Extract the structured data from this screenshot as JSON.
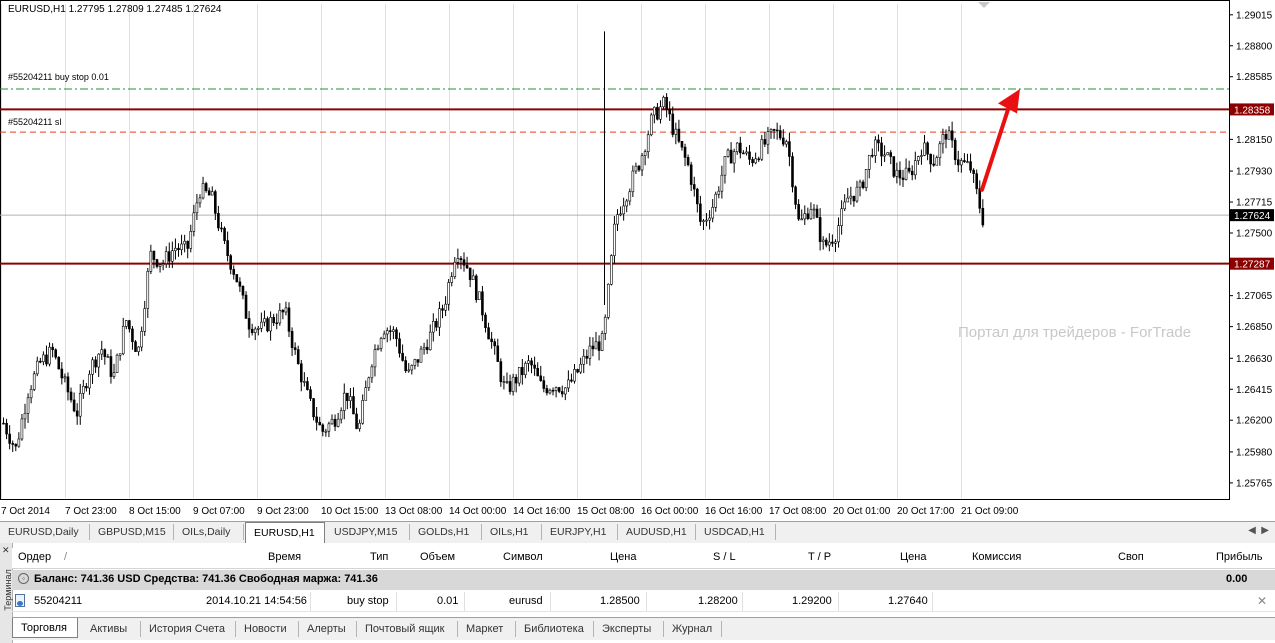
{
  "chart": {
    "info": "EURUSD,H1  1.27795 1.27809 1.27485 1.27624",
    "watermark": "Портал для трейдеров - ForTrade",
    "buy_stop_label": "#55204211 buy stop 0.01",
    "sl_label": "#55204211 sl",
    "buy_stop_price": 1.285,
    "sl_price": 1.282,
    "resistance_price": 1.28358,
    "support_price": 1.27287,
    "current_price": 1.27624,
    "resistance_label": "1.28358",
    "support_label": "1.27287",
    "current_label": "1.27624",
    "colors": {
      "level": "#8b0000",
      "buy_stop": "#2e8b2e",
      "sl": "#e04020",
      "arrow": "#e81010",
      "candle": "#000000"
    }
  },
  "chart_data": {
    "type": "candlestick",
    "title": "EURUSD,H1",
    "ylim": [
      1.2566,
      1.2909
    ],
    "y_ticks": [
      "1.29015",
      "1.28800",
      "1.28585",
      "1.28370",
      "1.28150",
      "1.27930",
      "1.27715",
      "1.27500",
      "1.27285",
      "1.27065",
      "1.26850",
      "1.26630",
      "1.26415",
      "1.26200",
      "1.25980",
      "1.25765"
    ],
    "x_ticks": [
      "7 Oct 2014",
      "7 Oct 23:00",
      "8 Oct 15:00",
      "9 Oct 07:00",
      "9 Oct 23:00",
      "10 Oct 15:00",
      "13 Oct 08:00",
      "14 Oct 00:00",
      "14 Oct 16:00",
      "15 Oct 08:00",
      "16 Oct 00:00",
      "16 Oct 16:00",
      "17 Oct 08:00",
      "20 Oct 01:00",
      "20 Oct 17:00",
      "21 Oct 09:00"
    ],
    "close_path": [
      1.2618,
      1.26,
      1.264,
      1.266,
      1.2668,
      1.2645,
      1.2625,
      1.2655,
      1.267,
      1.265,
      1.269,
      1.2667,
      1.2735,
      1.2729,
      1.274,
      1.2738,
      1.278,
      1.2775,
      1.2742,
      1.272,
      1.2688,
      1.2683,
      1.269,
      1.2695,
      1.266,
      1.2632,
      1.2612,
      1.262,
      1.264,
      1.2612,
      1.266,
      1.2685,
      1.268,
      1.265,
      1.2665,
      1.2681,
      1.27,
      1.274,
      1.2725,
      1.27,
      1.267,
      1.264,
      1.265,
      1.266,
      1.2642,
      1.2645,
      1.2642,
      1.2655,
      1.267,
      1.2675,
      1.276,
      1.278,
      1.28,
      1.283,
      1.284,
      1.2815,
      1.2795,
      1.2755,
      1.277,
      1.28,
      1.281,
      1.28,
      1.281,
      1.282,
      1.2815,
      1.2755,
      1.277,
      1.274,
      1.275,
      1.2775,
      1.278,
      1.281,
      1.2805,
      1.279,
      1.279,
      1.281,
      1.28,
      1.282,
      1.28,
      1.2795,
      1.276
    ],
    "levels": {
      "resistance": 1.28358,
      "support": 1.27287,
      "current": 1.27624,
      "buy_stop": 1.285,
      "stop_loss": 1.282
    }
  },
  "chart_tabs": [
    "EURUSD,Daily",
    "GBPUSD,M15",
    "OILs,Daily",
    "EURUSD,H1",
    "USDJPY,M15",
    "GOLDs,H1",
    "OILs,H1",
    "EURJPY,H1",
    "AUDUSD,H1",
    "USDCAD,H1"
  ],
  "active_chart_tab": "EURUSD,H1",
  "terminal": {
    "side_label": "Терминал",
    "headers": {
      "order": "Ордер",
      "time": "Время",
      "type": "Тип",
      "volume": "Объем",
      "symbol": "Символ",
      "price": "Цена",
      "sl": "S / L",
      "tp": "T / P",
      "price2": "Цена",
      "commission": "Комиссия",
      "swap": "Своп",
      "profit": "Прибыль"
    },
    "balance_text": "Баланс: 741.36 USD  Средства: 741.36  Свободная маржа: 741.36",
    "balance_profit": "0.00",
    "order": {
      "id": "55204211",
      "time": "2014.10.21 14:54:56",
      "type": "buy stop",
      "volume": "0.01",
      "symbol": "eurusd",
      "price": "1.28500",
      "sl": "1.28200",
      "tp": "1.29200",
      "current": "1.27640"
    }
  },
  "bottom_tabs": [
    "Торговля",
    "Активы",
    "История Счета",
    "Новости",
    "Алерты",
    "Почтовый ящик",
    "Маркет",
    "Библиотека",
    "Эксперты",
    "Журнал"
  ],
  "active_bottom_tab": "Торговля"
}
